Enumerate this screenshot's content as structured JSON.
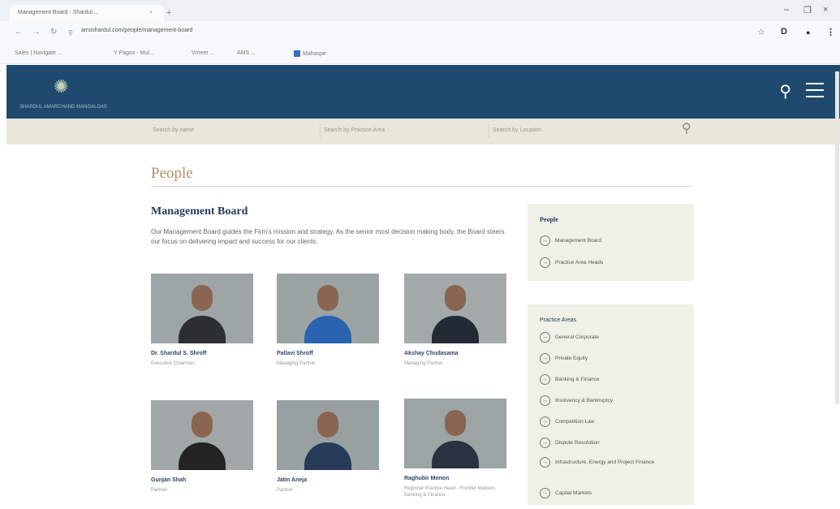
{
  "browser": {
    "tab_title": "Management Board - Shardul ...",
    "tab_close": "×",
    "new_tab": "+",
    "url": "amsshardul.com/people/management-board",
    "bookmarks": [
      "Sales | Navigate ...",
      "Y Pagos - Mul...",
      "Vmeet ...",
      "AMS ...",
      "Mahaspe"
    ],
    "win_minimize": "–",
    "win_restore": "❐",
    "win_close": "×"
  },
  "site": {
    "logo_text": "SHARDUL AMARCHAND MANGALDAS",
    "search_placeholders": [
      "Search by name",
      "Search by Practice Area",
      "Search by Location"
    ]
  },
  "page": {
    "title": "People",
    "section_title": "Management Board",
    "description": "Our Management Board guides the Firm's mission and strategy. As the senior most decision making body, the Board steers our focus on delivering impact and success for our clients."
  },
  "people": [
    {
      "name": "Dr. Shardul S. Shroff",
      "role": "Executive Chairman",
      "suit": "#2b2f33",
      "bg": "#9ea5a6"
    },
    {
      "name": "Pallavi Shroff",
      "role": "Managing Partner",
      "suit": "#2a63b0",
      "bg": "#9ba3a3"
    },
    {
      "name": "Akshay Chudasama",
      "role": "Managing Partner",
      "suit": "#222a35",
      "bg": "#a3aaa9"
    },
    {
      "name": "Gunjan Shah",
      "role": "Partner",
      "suit": "#232323",
      "bg": "#a2a8a7"
    },
    {
      "name": "Jatin Aneja",
      "role": "Partner",
      "suit": "#273a58",
      "bg": "#98a1a2"
    },
    {
      "name": "Raghubir Menon",
      "role": "Regional Practice Head - Frontier Markets, Banking & Finance",
      "suit": "#283240",
      "bg": "#9ca4a4"
    }
  ],
  "sidebar": {
    "people_heading": "People",
    "people_links": [
      "Management Board",
      "Practice Area Heads"
    ],
    "practice_heading": "Practice Areas",
    "practice_links": [
      "General Corporate",
      "Private Equity",
      "Banking & Finance",
      "Insolvency & Bankruptcy",
      "Competition Law",
      "Dispute Resolution",
      "Infrastructure, Energy and Project Finance",
      "Capital Markets"
    ]
  },
  "colors": {
    "header_bg": "#1f4a6d",
    "accent_title": "#b08f66",
    "sidebar_bg": "#eff1e6"
  }
}
